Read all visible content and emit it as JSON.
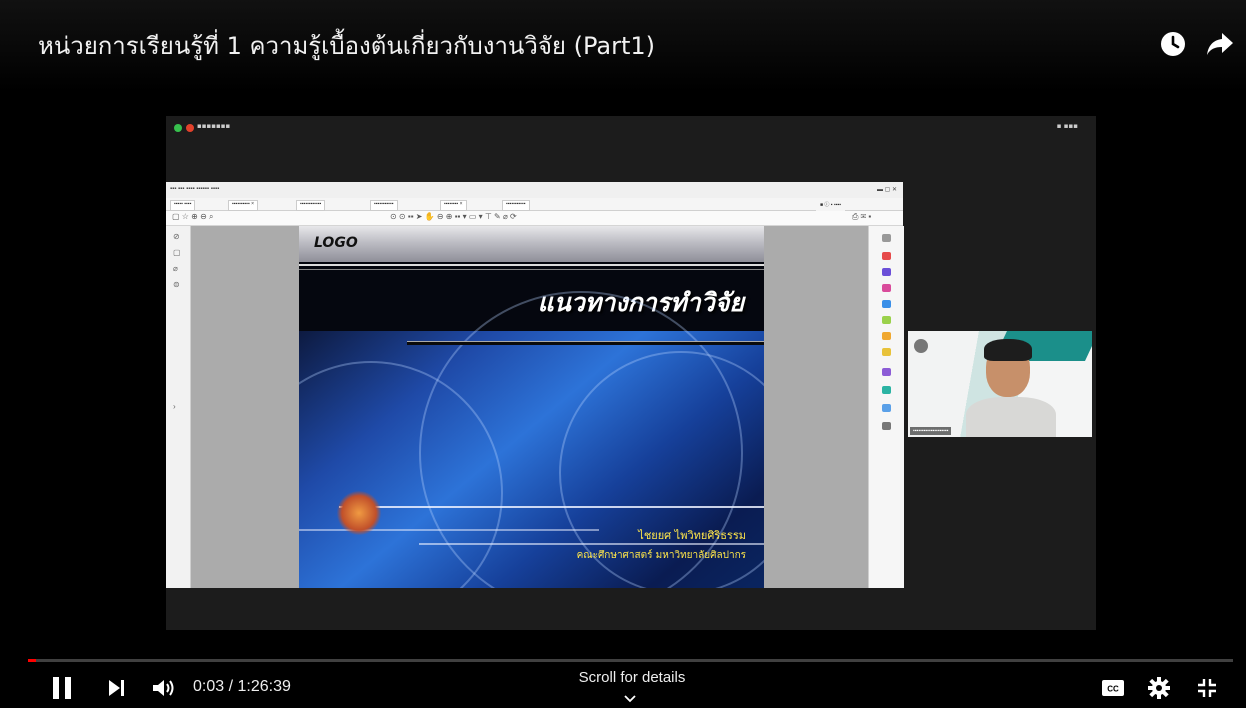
{
  "video": {
    "title": "หน่วยการเรียนรู้ที่ 1 ความรู้เบื้องต้นเกี่ยวกับงานวิจัย (Part1)",
    "current_time": "0:03",
    "duration": "1:26:39",
    "time_text": "0:03 / 1:26:39",
    "progress_fraction": 0.0006
  },
  "top_actions": {
    "watch_later_icon": "clock-icon",
    "share_icon": "share-arrow-icon"
  },
  "controls": {
    "scroll_hint": "Scroll for details",
    "icons": [
      "pause-icon",
      "next-icon",
      "volume-icon",
      "captions-icon",
      "settings-icon",
      "exit-fullscreen-icon"
    ]
  },
  "slide": {
    "logo_text": "LOGO",
    "heading": "แนวทางการทำวิจัย",
    "author": "ไชยยศ ไพวิทยศิริธรรม",
    "faculty": "คณะศึกษาศาสตร์ มหาวิทยาลัยศิลปากร"
  },
  "colors": {
    "progress": "#ff0000",
    "slide_text": "#ffe64a",
    "background": "#000000"
  }
}
